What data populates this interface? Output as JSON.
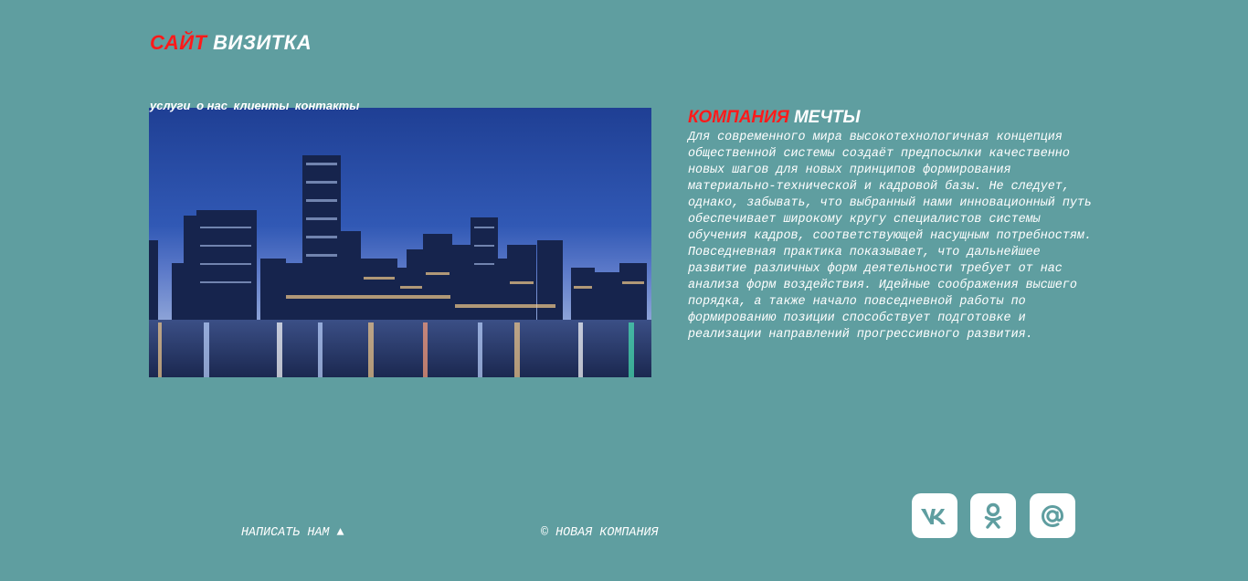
{
  "header": {
    "logo_accent": "САЙТ",
    "logo_main": "ВИЗИТКА"
  },
  "nav": {
    "items": [
      {
        "label": "услуги"
      },
      {
        "label": "о нас"
      },
      {
        "label": "клиенты"
      },
      {
        "label": "контакты"
      }
    ]
  },
  "main": {
    "heading_accent": "КОМПАНИЯ",
    "heading_main": "МЕЧТЫ",
    "body": "Для современного мира высокотехнологичная концепция общественной системы создаёт предпосылки качественно новых шагов для новых принципов формирования материально-технической и кадровой базы. Не следует, однако, забывать, что выбранный нами инновационный путь обеспечивает широкому кругу специалистов системы обучения кадров, соответствующей насущным потребностям. Повседневная практика показывает, что дальнейшее развитие различных форм деятельности требует от нас анализа форм воздействия. Идейные соображения высшего порядка, а также начало повседневной работы по формированию позиции способствует подготовке и реализации направлений прогрессивного развития."
  },
  "footer": {
    "write_label": "НАПИСАТЬ НАМ ▲",
    "copyright": "© НОВАЯ КОМПАНИЯ"
  },
  "social": [
    {
      "icon": "vk-icon"
    },
    {
      "icon": "odnoklassniki-icon"
    },
    {
      "icon": "at-sign-icon"
    }
  ],
  "colors": {
    "background": "#5f9ea0",
    "accent": "#ff1a1a",
    "text": "#ffffff"
  }
}
